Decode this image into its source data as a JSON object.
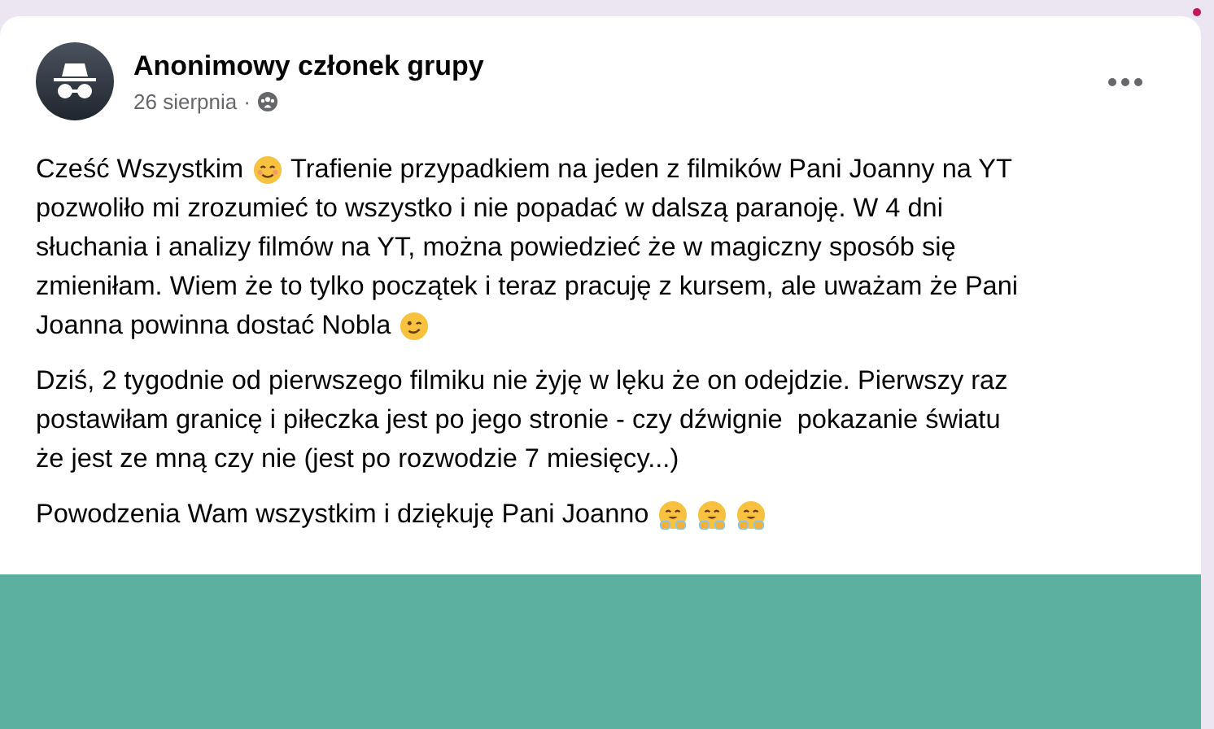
{
  "post": {
    "author": "Anonimowy członek grupy",
    "date": "26 sierpnia",
    "separator": "·",
    "paragraphs": [
      [
        [
          {
            "kind": "text",
            "text": "Cześć Wszystkim"
          },
          {
            "kind": "smile"
          },
          {
            "kind": "text",
            "text": "Trafienie przypadkiem na jeden z filmików Pani Joanny na YT"
          }
        ],
        [
          {
            "kind": "text",
            "text": "pozwoliło mi zrozumieć to wszystko i nie popadać w dalszą paranoję. W 4 dni"
          }
        ],
        [
          {
            "kind": "text",
            "text": "słuchania i analizy filmów na YT, można powiedzieć że w magiczny sposób się"
          }
        ],
        [
          {
            "kind": "text",
            "text": "zmieniłam. Wiem że to tylko początek i teraz pracuję z kursem, ale uważam że Pani"
          }
        ],
        [
          {
            "kind": "text",
            "text": "Joanna powinna dostać Nobla"
          },
          {
            "kind": "wink"
          }
        ]
      ],
      [
        [
          {
            "kind": "text",
            "text": "Dziś, 2 tygodnie od pierwszego filmiku nie żyję w lęku że on odejdzie. Pierwszy raz"
          }
        ],
        [
          {
            "kind": "text",
            "text": "postawiłam granicę i piłeczka jest po jego stronie - czy dźwignie  pokazanie światu"
          }
        ],
        [
          {
            "kind": "text",
            "text": "że jest ze mną czy nie (jest po rozwodzie 7 miesięcy...)"
          }
        ]
      ],
      [
        [
          {
            "kind": "text",
            "text": "Powodzenia Wam wszystkim i dziękuję Pani Joanno"
          },
          {
            "kind": "hug"
          },
          {
            "kind": "hug"
          },
          {
            "kind": "hug"
          }
        ]
      ]
    ],
    "media": {
      "kind": "picture"
    }
  }
}
